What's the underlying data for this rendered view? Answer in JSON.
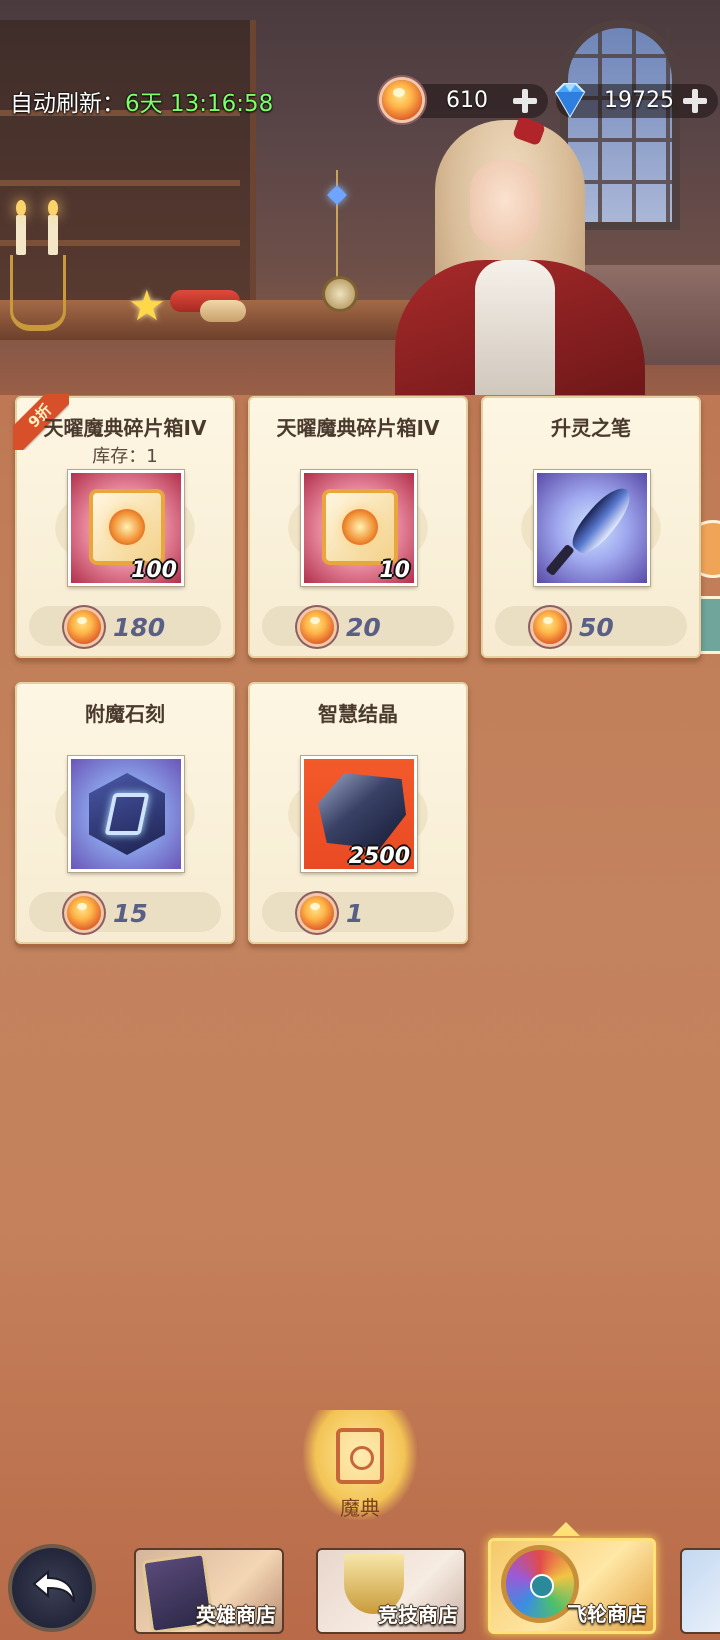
{
  "hud": {
    "refresh_label": "自动刷新：",
    "refresh_timer": "6天 13:16:58",
    "gold_amount": "610",
    "gem_amount": "19725",
    "coin_icon": "gold-coin-icon",
    "gem_icon": "diamond-icon"
  },
  "shop_items": [
    {
      "name": "天曜魔典碎片箱IV",
      "stock": "库存：1",
      "badge": "9折",
      "quantity": "100",
      "price": "180",
      "art": "relic-box"
    },
    {
      "name": "天曜魔典碎片箱IV",
      "quantity": "10",
      "price": "20",
      "art": "relic-box"
    },
    {
      "name": "升灵之笔",
      "price": "50",
      "art": "quill"
    },
    {
      "name": "附魔石刻",
      "price": "15",
      "art": "rune-stone"
    },
    {
      "name": "智慧结晶",
      "quantity": "2500",
      "price": "1",
      "art": "crystal"
    }
  ],
  "bottom_nav": {
    "center_tab_label": "魔典",
    "tabs": [
      {
        "label": "英雄商店"
      },
      {
        "label": "竞技商店"
      },
      {
        "label": "飞轮商店",
        "active": true
      }
    ]
  },
  "colors": {
    "timer": "#7dff6a",
    "price_text": "#5a5f86",
    "badge": "#d7502a",
    "active_tab_border": "#ffe27a"
  }
}
